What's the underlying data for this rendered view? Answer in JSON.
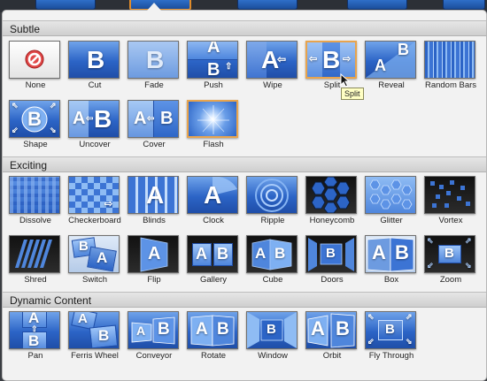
{
  "sections": [
    {
      "title": "Subtle",
      "items": [
        {
          "label": "None",
          "icon": "none-icon"
        },
        {
          "label": "Cut",
          "icon": "cut-icon"
        },
        {
          "label": "Fade",
          "icon": "fade-icon"
        },
        {
          "label": "Push",
          "icon": "push-icon"
        },
        {
          "label": "Wipe",
          "icon": "wipe-icon"
        },
        {
          "label": "Split",
          "icon": "split-icon"
        },
        {
          "label": "Reveal",
          "icon": "reveal-icon"
        },
        {
          "label": "Random Bars",
          "icon": "random-bars-icon"
        },
        {
          "label": "Shape",
          "icon": "shape-icon"
        },
        {
          "label": "Uncover",
          "icon": "uncover-icon"
        },
        {
          "label": "Cover",
          "icon": "cover-icon"
        },
        {
          "label": "Flash",
          "icon": "flash-icon"
        }
      ]
    },
    {
      "title": "Exciting",
      "items": [
        {
          "label": "Dissolve",
          "icon": "dissolve-icon"
        },
        {
          "label": "Checkerboard",
          "icon": "checkerboard-icon"
        },
        {
          "label": "Blinds",
          "icon": "blinds-icon"
        },
        {
          "label": "Clock",
          "icon": "clock-icon"
        },
        {
          "label": "Ripple",
          "icon": "ripple-icon"
        },
        {
          "label": "Honeycomb",
          "icon": "honeycomb-icon"
        },
        {
          "label": "Glitter",
          "icon": "glitter-icon"
        },
        {
          "label": "Vortex",
          "icon": "vortex-icon"
        },
        {
          "label": "Shred",
          "icon": "shred-icon"
        },
        {
          "label": "Switch",
          "icon": "switch-icon"
        },
        {
          "label": "Flip",
          "icon": "flip-icon"
        },
        {
          "label": "Gallery",
          "icon": "gallery-icon"
        },
        {
          "label": "Cube",
          "icon": "cube-icon"
        },
        {
          "label": "Doors",
          "icon": "doors-icon"
        },
        {
          "label": "Box",
          "icon": "box-icon"
        },
        {
          "label": "Zoom",
          "icon": "zoom-icon"
        }
      ]
    },
    {
      "title": "Dynamic Content",
      "items": [
        {
          "label": "Pan",
          "icon": "pan-icon"
        },
        {
          "label": "Ferris Wheel",
          "icon": "ferris-wheel-icon"
        },
        {
          "label": "Conveyor",
          "icon": "conveyor-icon"
        },
        {
          "label": "Rotate",
          "icon": "rotate-icon"
        },
        {
          "label": "Window",
          "icon": "window-icon"
        },
        {
          "label": "Orbit",
          "icon": "orbit-icon"
        },
        {
          "label": "Fly Through",
          "icon": "fly-through-icon"
        }
      ]
    }
  ],
  "thumb_glyphs": {
    "a": "A",
    "b": "B"
  },
  "tooltip": "Split",
  "selected_transitions": [
    "Split",
    "Flash"
  ],
  "colors": {
    "selection": "#e8a44d",
    "thumb_blue": "#2c64c6",
    "panel_bg": "#f2f2f2",
    "header_bg": "#d9d9d9"
  }
}
